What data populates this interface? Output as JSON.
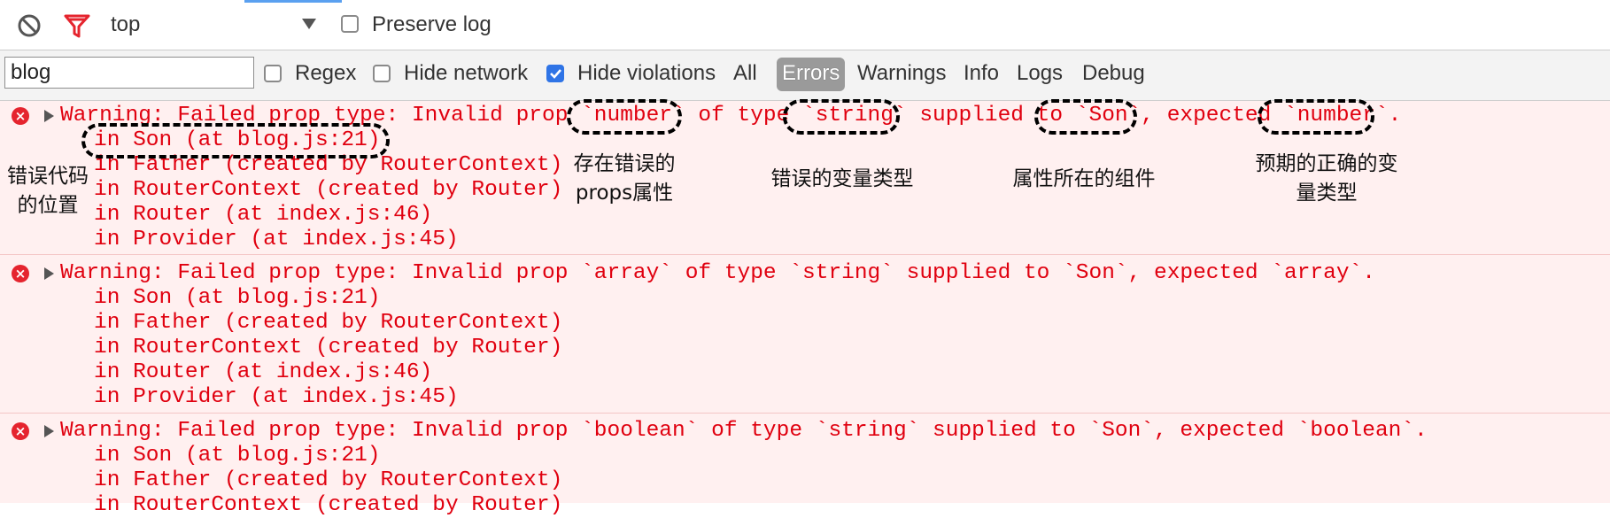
{
  "toolbar": {
    "context_value": "top",
    "preserve_log_label": "Preserve log",
    "preserve_log_checked": false
  },
  "filter": {
    "value": "blog",
    "regex_label": "Regex",
    "hide_network_label": "Hide network",
    "hide_violations_label": "Hide violations",
    "levels": [
      "All",
      "Errors",
      "Warnings",
      "Info",
      "Logs",
      "Debug"
    ],
    "selected_level": "Errors"
  },
  "messages": [
    {
      "text": "Warning: Failed prop type: Invalid prop `number` of type `string` supplied to `Son`, expected `number`.",
      "stack": [
        "in Son (at blog.js:21)",
        "in Father (created by RouterContext)",
        "in RouterContext (created by Router)",
        "in Router (at index.js:46)",
        "in Provider (at index.js:45)"
      ]
    },
    {
      "text": "Warning: Failed prop type: Invalid prop `array` of type `string` supplied to `Son`, expected `array`.",
      "stack": [
        "in Son (at blog.js:21)",
        "in Father (created by RouterContext)",
        "in RouterContext (created by Router)",
        "in Router (at index.js:46)",
        "in Provider (at index.js:45)"
      ]
    },
    {
      "text": "Warning: Failed prop type: Invalid prop `boolean` of type `string` supplied to `Son`, expected `boolean`.",
      "stack": [
        "in Son (at blog.js:21)",
        "in Father (created by RouterContext)",
        "in RouterContext (created by Router)"
      ]
    }
  ],
  "annotations": {
    "error_location": [
      "错误代码",
      "的位置"
    ],
    "wrong_prop": [
      "存在错误的",
      "props属性"
    ],
    "wrong_type": [
      "错误的变量类型"
    ],
    "component": [
      "属性所在的组件"
    ],
    "expected_type": [
      "预期的正确的变",
      "量类型"
    ]
  },
  "colors": {
    "error_text": "#e0000f",
    "error_bg": "#fff0f0",
    "checkbox_checked": "#2f74e6",
    "level_pill": "#9a9a9a"
  },
  "icons": [
    "block-icon",
    "filter-icon",
    "dropdown-arrow-icon",
    "error-icon",
    "expand-triangle-icon"
  ]
}
